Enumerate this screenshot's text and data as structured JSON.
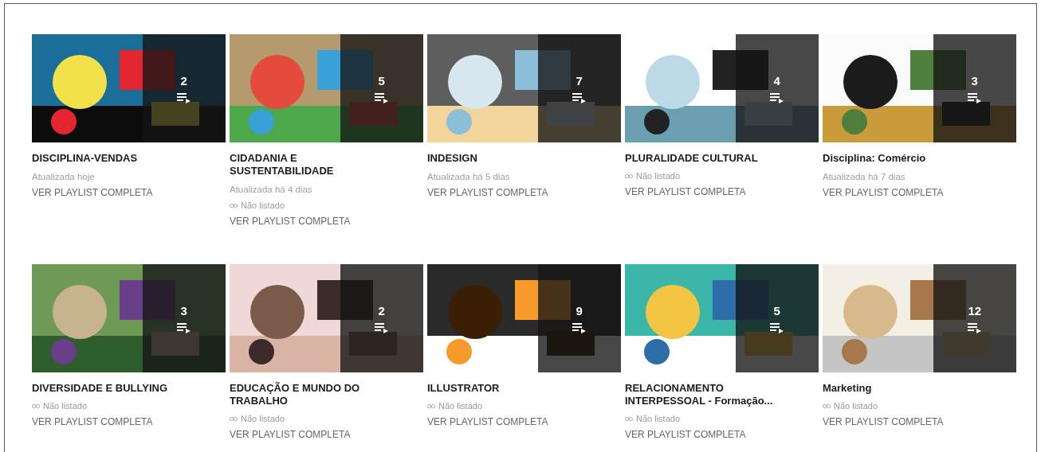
{
  "playlists": [
    {
      "title": "DISCIPLINA-VENDAS",
      "updated": "Atualizada hoje",
      "link": "VER PLAYLIST COMPLETA",
      "count": "2"
    },
    {
      "title": "CIDADANIA E SUSTENTABILIDADE",
      "updated": "Atualizada há 4 dias",
      "visibility": "Não listado",
      "link": "VER PLAYLIST COMPLETA",
      "count": "5"
    },
    {
      "title": "INDESIGN",
      "updated": "Atualizada há 5 dias",
      "link": "VER PLAYLIST COMPLETA",
      "count": "7"
    },
    {
      "title": "PLURALIDADE CULTURAL",
      "visibility": "Não listado",
      "link": "VER PLAYLIST COMPLETA",
      "count": "4"
    },
    {
      "title": "Disciplina: Comércio",
      "updated": "Atualizada há 7 dias",
      "link": "VER PLAYLIST COMPLETA",
      "count": "3"
    },
    {
      "title": "DIVERSIDADE E BULLYING",
      "visibility": "Não listado",
      "link": "VER PLAYLIST COMPLETA",
      "count": "3"
    },
    {
      "title": "EDUCAÇÃO E MUNDO DO TRABALHO",
      "visibility": "Não listado",
      "link": "VER PLAYLIST COMPLETA",
      "count": "2"
    },
    {
      "title": "ILLUSTRATOR",
      "visibility": "Não listado",
      "link": "VER PLAYLIST COMPLETA",
      "count": "9"
    },
    {
      "title": "RELACIONAMENTO INTERPESSOAL - Formação...",
      "visibility": "Não listado",
      "link": "VER PLAYLIST COMPLETA",
      "count": "5"
    },
    {
      "title": "Marketing",
      "visibility": "Não listado",
      "link": "VER PLAYLIST COMPLETA",
      "count": "12"
    }
  ]
}
